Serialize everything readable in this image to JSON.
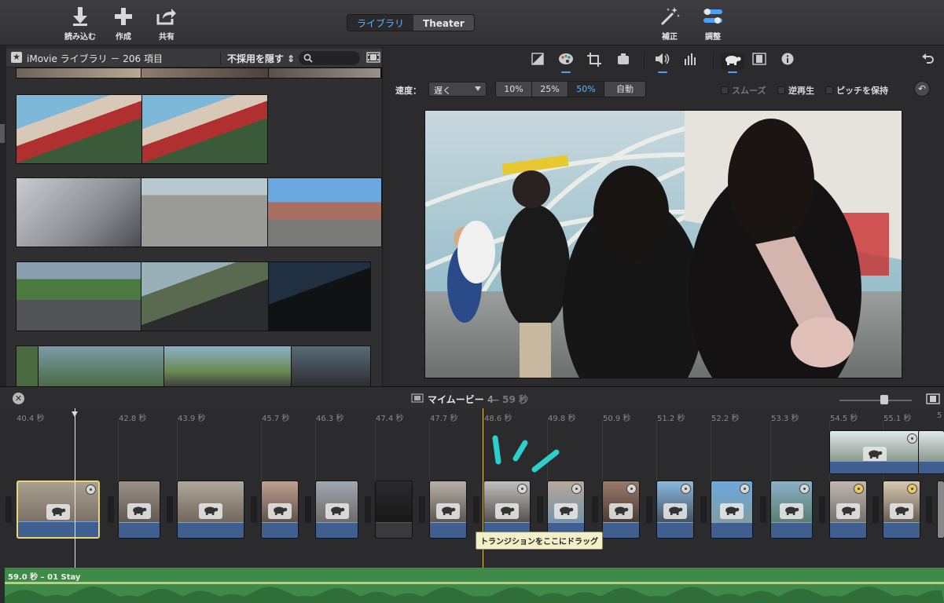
{
  "toolbar": {
    "import_label": "読み込む",
    "create_label": "作成",
    "share_label": "共有",
    "view_tabs": [
      "ライブラリ",
      "Theater"
    ],
    "enhance_label": "補正",
    "adjust_label": "調整"
  },
  "library": {
    "title": "iMovie ライブラリ － 206 項目",
    "filter_label": "不採用を隠す ⇕",
    "search_placeholder": ""
  },
  "speed_panel": {
    "speed_label": "速度：",
    "speed_value": "遅く",
    "presets": [
      "10%",
      "25%",
      "50%",
      "自動"
    ],
    "selected_preset": "50%",
    "smooth_label": "スムーズ",
    "reverse_label": "逆再生",
    "preserve_pitch_label": "ピッチを保持"
  },
  "timeline": {
    "project_title": "マイムービー",
    "project_number": "4",
    "duration": "— 59 秒",
    "ruler": [
      "40.4 秒",
      "42.8 秒",
      "43.9 秒",
      "45.7 秒",
      "46.3 秒",
      "47.4 秒",
      "47.7 秒",
      "48.6 秒",
      "49.8 秒",
      "50.9 秒",
      "51.2 秒",
      "52.2 秒",
      "53.3 秒",
      "54.5 秒",
      "55.1 秒",
      "5"
    ],
    "tooltip": "トランジションをここにドラッグ",
    "music_label": "59.0 秒 – 01 Stay"
  },
  "icons": {
    "import": "download-arrow-icon",
    "create": "plus-icon",
    "share": "share-icon",
    "enhance": "magic-wand-icon",
    "adjust": "sliders-icon",
    "speed": "turtle-icon"
  },
  "colors": {
    "accent": "#5fb4ff",
    "clip_bar": "#3f5f91",
    "audio_track": "#3f8a48",
    "selection": "#e8d67a",
    "skimmer": "#e6c44a"
  }
}
